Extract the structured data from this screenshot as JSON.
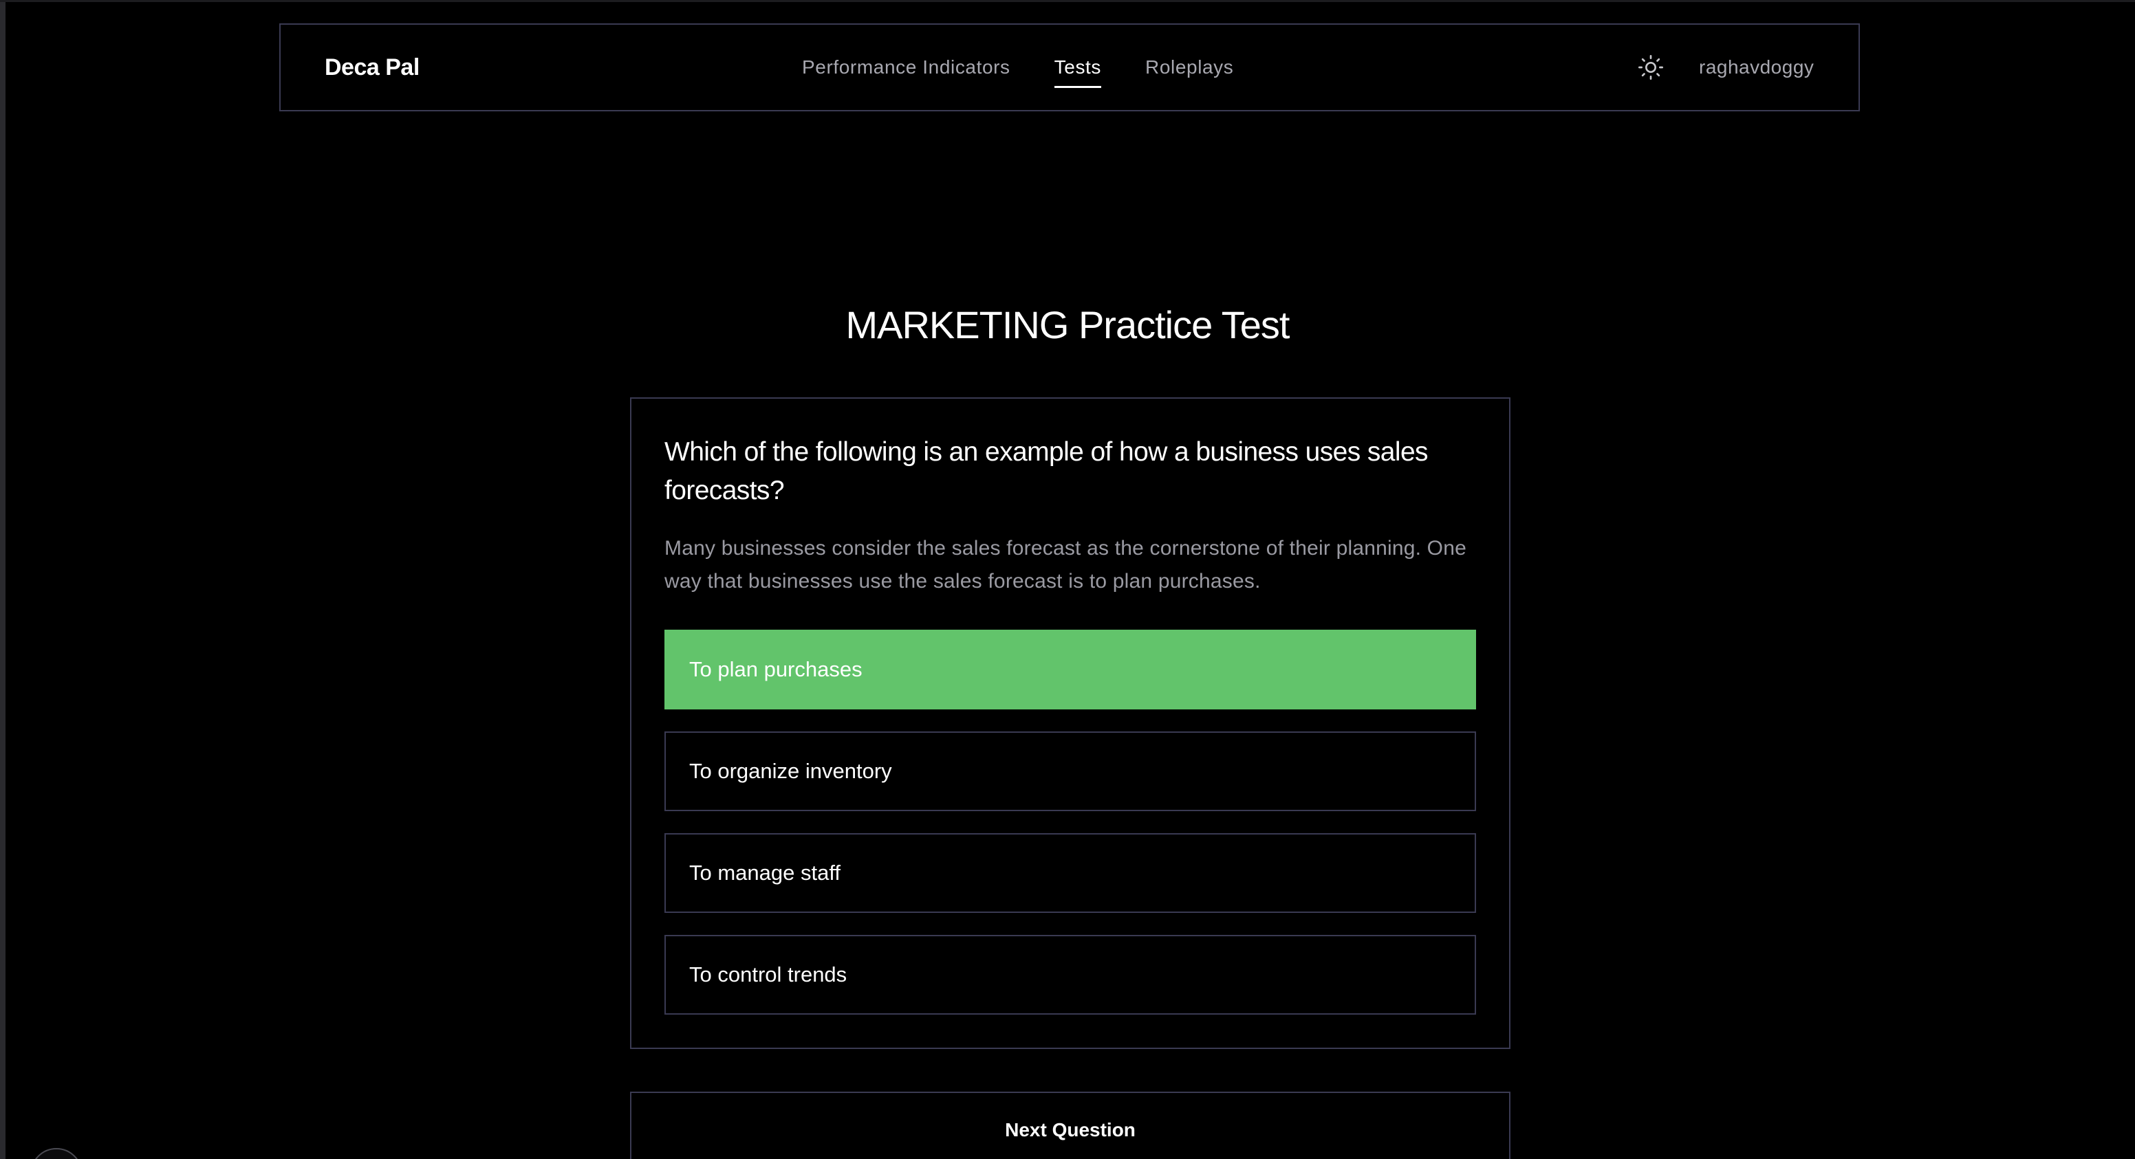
{
  "header": {
    "brand": "Deca Pal",
    "nav": [
      {
        "label": "Performance Indicators",
        "active": false
      },
      {
        "label": "Tests",
        "active": true
      },
      {
        "label": "Roleplays",
        "active": false
      }
    ],
    "theme_icon": "sun-icon",
    "username": "raghavdoggy"
  },
  "main": {
    "title": "MARKETING Practice Test",
    "question": "Which of the following is an example of how a business uses sales forecasts?",
    "explanation": "Many businesses consider the sales forecast as the cornerstone of their planning. One way that businesses use the sales forecast is to plan purchases.",
    "options": [
      {
        "label": "To plan purchases",
        "state": "correct"
      },
      {
        "label": "To organize inventory",
        "state": "default"
      },
      {
        "label": "To manage staff",
        "state": "default"
      },
      {
        "label": "To control trends",
        "state": "default"
      }
    ],
    "next_label": "Next Question"
  },
  "colors": {
    "background": "#000000",
    "border": "#3a3a52",
    "correct": "#62c46b",
    "muted_text": "#a8a8b0"
  }
}
